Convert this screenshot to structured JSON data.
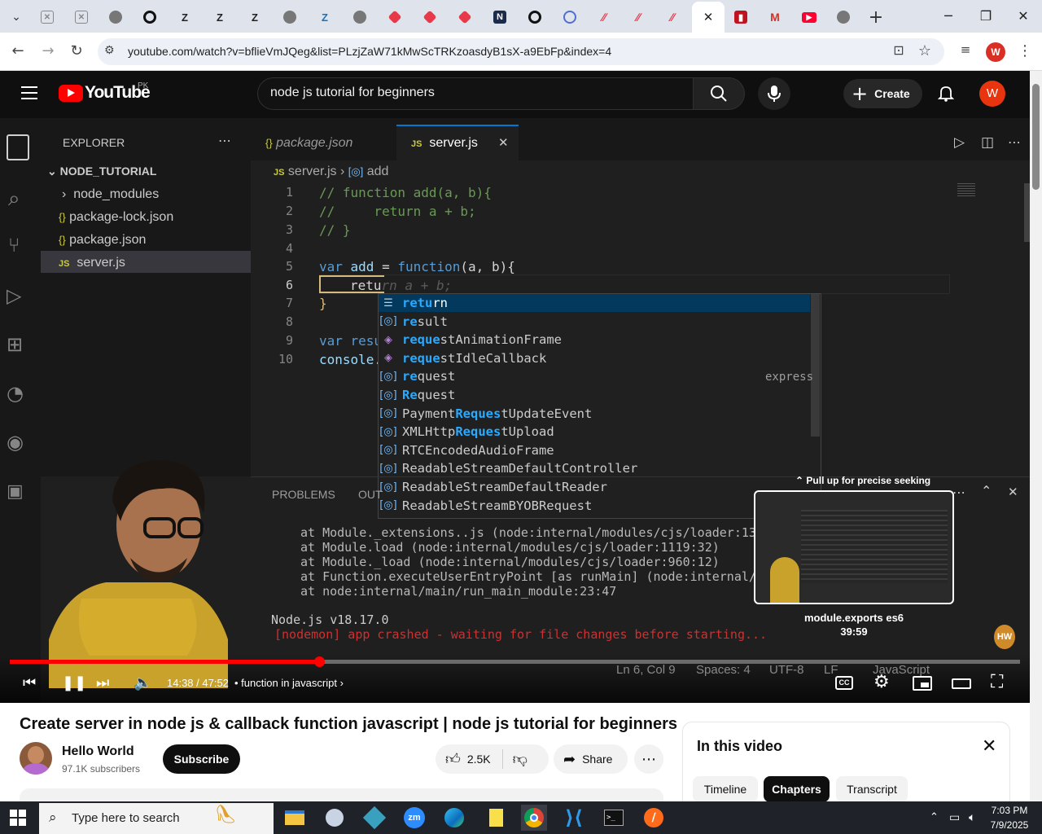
{
  "browser": {
    "url": "youtube.com/watch?v=bflieVmJQeg&list=PLzjZaW71kMwScTRKzoasdyB1sX-a9EbFp&index=4",
    "profile_initial": "W",
    "tab_favicon_letters": [
      "Z",
      "Z",
      "Z",
      "Z"
    ]
  },
  "youtube": {
    "logo_text": "YouTube",
    "region": "PK",
    "search_value": "node js tutorial for beginners",
    "create_label": "Create",
    "avatar_initial": "W"
  },
  "vscode": {
    "explorer_title": "EXPLORER",
    "project": "NODE_TUTORIAL",
    "files": [
      "node_modules",
      "package-lock.json",
      "package.json",
      "server.js"
    ],
    "tab_inactive": "package.json",
    "tab_active": "server.js",
    "breadcrumb_file": "server.js",
    "breadcrumb_symbol": "add",
    "line_numbers": [
      "1",
      "2",
      "3",
      "4",
      "5",
      "6",
      "7",
      "8",
      "9",
      "10"
    ],
    "code_lines": {
      "l1": "// function add(a, b){",
      "l2": "//     return a + b;",
      "l3": "// }",
      "l5_var": "var ",
      "l5_name": "add",
      "l5_eq": " = ",
      "l5_fn": "function",
      "l5_rest": "(a, b){",
      "l6_typed": "retu",
      "l6_ghost": "rn a + b;",
      "l7": "}",
      "l9": "var resu",
      "l10": "console."
    },
    "suggestions": [
      {
        "pre": "",
        "match": "retu",
        "post": "rn"
      },
      {
        "pre": "",
        "match": "re",
        "post": "sult"
      },
      {
        "pre": "",
        "match": "reque",
        "post": "stAnimationFrame"
      },
      {
        "pre": "",
        "match": "reque",
        "post": "stIdleCallback"
      },
      {
        "pre": "",
        "match": "re",
        "post": "quest"
      },
      {
        "pre": "",
        "match": "Re",
        "post": "quest"
      },
      {
        "pre": "Payment",
        "match": "Reques",
        "post": "tUpdateEvent"
      },
      {
        "pre": "XMLHttp",
        "match": "Reques",
        "post": "tUpload"
      },
      {
        "pre": "RTCEncodedAudioFrame",
        "match": "",
        "post": ""
      },
      {
        "pre": "ReadableStreamDefaultController",
        "match": "",
        "post": ""
      },
      {
        "pre": "ReadableStreamDefaultReader",
        "match": "",
        "post": ""
      },
      {
        "pre": "ReadableStreamBYOBRequest",
        "match": "",
        "post": ""
      }
    ],
    "suggest_detail": "express",
    "panel_tabs": [
      "PROBLEMS",
      "OUT"
    ],
    "terminal_lines": [
      "at Module._extensions..js (node:internal/modules/cjs/loader:1310",
      "at Module.load (node:internal/modules/cjs/loader:1119:32)",
      "at Module._load (node:internal/modules/cjs/loader:960:12)",
      "at Function.executeUserEntryPoint [as runMain] (node:internal/mo",
      "at node:internal/main/run_main_module:23:47"
    ],
    "node_version": "Node.js v18.17.0",
    "crash_line": "[nodemon] app crashed - waiting for file changes before starting...",
    "status": [
      "Ln 6, Col 9",
      "Spaces: 4",
      "UTF-8",
      "LF",
      "JavaScript"
    ]
  },
  "player": {
    "time": "14:38 / 47:52",
    "chapter": "function in javascript",
    "progress_percent": 30.6,
    "seek_hint": "Pull up for precise seeking",
    "preview_chapter": "module.exports es6",
    "preview_time": "39:59",
    "watermark": "HW"
  },
  "video_info": {
    "title": "Create server in node js & callback function javascript | node js tutorial for beginners",
    "channel": "Hello World",
    "subscribers": "97.1K subscribers",
    "subscribe_label": "Subscribe",
    "likes": "2.5K",
    "share_label": "Share"
  },
  "chapters_panel": {
    "title": "In this video",
    "tabs": [
      "Timeline",
      "Chapters",
      "Transcript"
    ],
    "active_tab": "Chapters"
  },
  "taskbar": {
    "search_placeholder": "Type here to search",
    "time": "7:03 PM",
    "date": "7/9/2025"
  },
  "colors": {
    "yt_red": "#ff0000",
    "vscode_bg": "#1f1f1f",
    "accent_blue": "#0078d4",
    "comment_green": "#6a9955"
  }
}
